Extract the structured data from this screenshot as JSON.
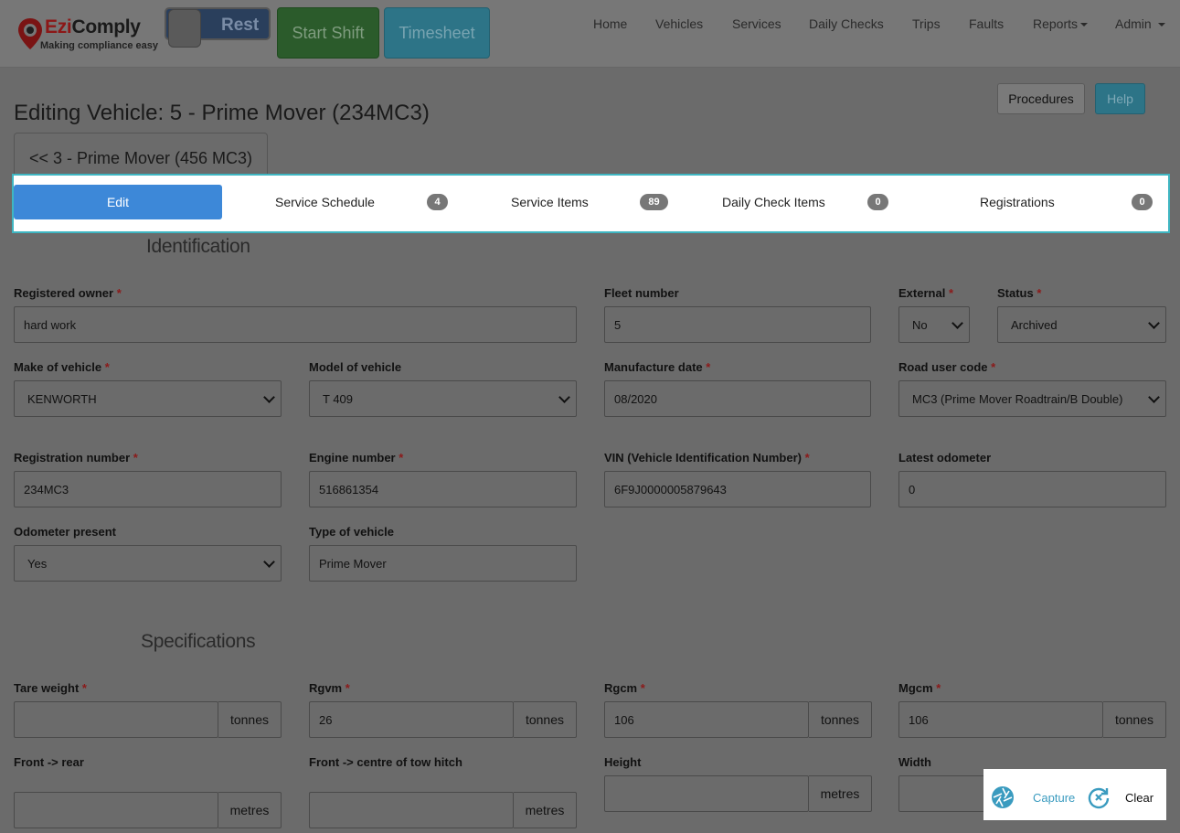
{
  "brand": {
    "name_red": "Ezi",
    "name_dark": "Comply",
    "tagline": "Making compliance easy",
    "accent": "#8c1717"
  },
  "toolbar": {
    "rest_label": "Rest",
    "start_shift_label": "Start Shift",
    "timesheet_label": "Timesheet"
  },
  "nav": {
    "home": "Home",
    "vehicles": "Vehicles",
    "services": "Services",
    "daily_checks": "Daily Checks",
    "trips": "Trips",
    "faults": "Faults",
    "reports": "Reports",
    "admin": "Admin"
  },
  "header": {
    "title": "Editing Vehicle: 5 - Prime Mover (234MC3)",
    "procedures_label": "Procedures",
    "help_label": "Help",
    "prev_vehicle_label": "<< 3 - Prime Mover (456 MC3)"
  },
  "tabs": {
    "edit": "Edit",
    "service_schedule": {
      "label": "Service Schedule",
      "count": "4"
    },
    "service_items": {
      "label": "Service Items",
      "count": "89"
    },
    "daily_check_items": {
      "label": "Daily Check Items",
      "count": "0"
    },
    "registrations": {
      "label": "Registrations",
      "count": "0"
    }
  },
  "identification": {
    "title": "Identification",
    "registered_owner": {
      "label": "Registered owner",
      "value": "hard work"
    },
    "fleet_number": {
      "label": "Fleet number",
      "value": "5"
    },
    "external": {
      "label": "External",
      "value": "No"
    },
    "status": {
      "label": "Status",
      "value": "Archived"
    },
    "make": {
      "label": "Make of vehicle",
      "value": "KENWORTH"
    },
    "model": {
      "label": "Model of vehicle",
      "value": "T 409"
    },
    "manufacture_date": {
      "label": "Manufacture date",
      "value": "08/2020"
    },
    "road_user_code": {
      "label": "Road user code",
      "value": "MC3 (Prime Mover Roadtrain/B Double)"
    },
    "registration_number": {
      "label": "Registration number",
      "value": "234MC3"
    },
    "engine_number": {
      "label": "Engine number",
      "value": "516861354"
    },
    "vin": {
      "label": "VIN (Vehicle Identification Number)",
      "value": "6F9J0000005879643"
    },
    "latest_odometer": {
      "label": "Latest odometer",
      "value": "0"
    },
    "odometer_present": {
      "label": "Odometer present",
      "value": "Yes"
    },
    "type_of_vehicle": {
      "label": "Type of vehicle",
      "value": "Prime Mover"
    }
  },
  "specifications": {
    "title": "Specifications",
    "unit_tonnes": "tonnes",
    "unit_metres": "metres",
    "tare_weight": {
      "label": "Tare weight",
      "value": ""
    },
    "rgvm": {
      "label": "Rgvm",
      "value": "26"
    },
    "rgcm": {
      "label": "Rgcm",
      "value": "106"
    },
    "mgcm": {
      "label": "Mgcm",
      "value": "106"
    },
    "front_rear": {
      "label": "Front -> rear",
      "value": ""
    },
    "front_tow": {
      "label": "Front -> centre of tow hitch",
      "value": ""
    },
    "height": {
      "label": "Height",
      "value": ""
    },
    "width": {
      "label": "Width",
      "value": ""
    }
  },
  "required_marker": "*",
  "capture_widget": {
    "capture_label": "Capture",
    "clear_label": "Clear",
    "icon_color": "#3a9bbf"
  }
}
